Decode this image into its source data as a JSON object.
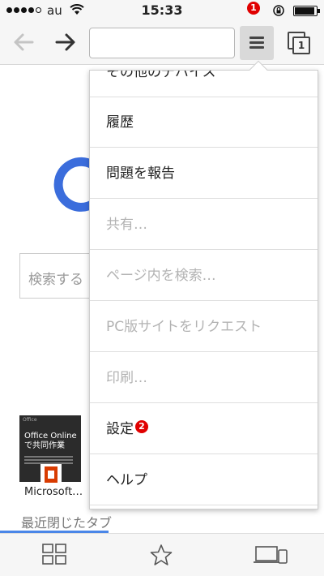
{
  "status_bar": {
    "carrier": "au",
    "time": "15:33"
  },
  "toolbar": {
    "address_value": "",
    "tab_count": "1",
    "menu_badge": "1"
  },
  "page": {
    "search_placeholder": "検索する",
    "thumbnail": {
      "header": "Office",
      "title": "Office Online で共同作業",
      "label": "Microsoft…"
    },
    "recently_closed_tab": "最近閉じたタブ"
  },
  "menu": {
    "items": [
      {
        "label": "その他のデバイス",
        "enabled": true
      },
      {
        "label": "履歴",
        "enabled": true
      },
      {
        "label": "問題を報告",
        "enabled": true
      },
      {
        "label": "共有…",
        "enabled": false
      },
      {
        "label": "ページ内を検索…",
        "enabled": false
      },
      {
        "label": "PC版サイトをリクエスト",
        "enabled": false
      },
      {
        "label": "印刷…",
        "enabled": false
      },
      {
        "label": "設定",
        "enabled": true
      },
      {
        "label": "ヘルプ",
        "enabled": true
      }
    ],
    "settings_badge": "2"
  },
  "colors": {
    "badge_red": "#e00000",
    "accent_blue": "#4a86e8",
    "google_blue": "#3b6ddc",
    "disabled_text": "#b3b3b3"
  },
  "icons": {
    "back": "arrow-left-icon",
    "forward": "arrow-right-icon",
    "menu": "hamburger-menu-icon",
    "tabs": "tab-switcher-icon",
    "bottom": [
      "grid-icon",
      "star-icon",
      "devices-icon"
    ]
  }
}
